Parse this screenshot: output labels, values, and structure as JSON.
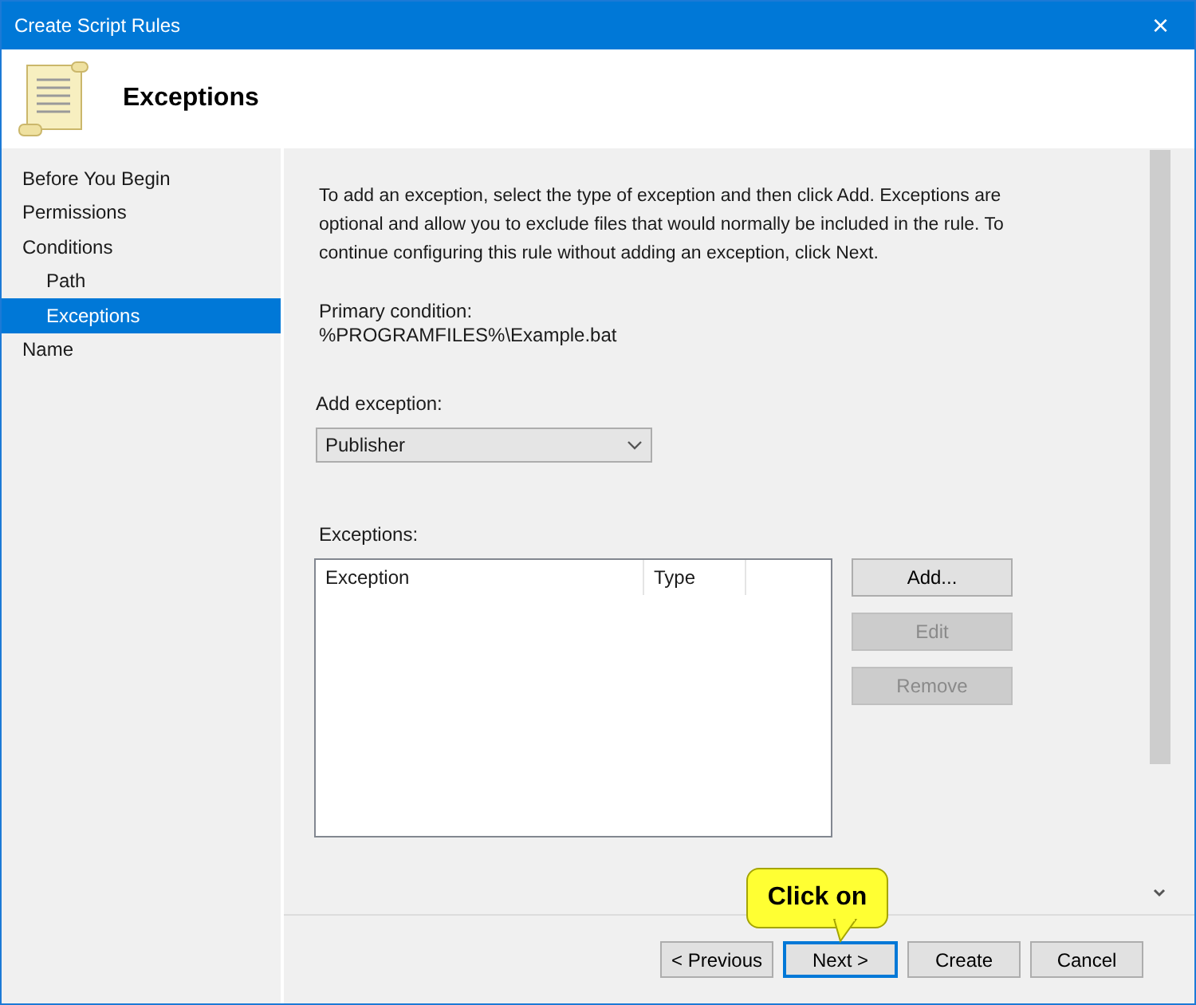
{
  "window": {
    "title": "Create Script Rules",
    "close": "×"
  },
  "header": {
    "title": "Exceptions"
  },
  "sidebar": {
    "items": [
      {
        "label": "Before You Begin",
        "selected": false
      },
      {
        "label": "Permissions",
        "selected": false
      },
      {
        "label": "Conditions",
        "selected": false,
        "children": [
          {
            "label": "Path",
            "selected": false
          },
          {
            "label": "Exceptions",
            "selected": true
          }
        ]
      },
      {
        "label": "Name",
        "selected": false
      }
    ]
  },
  "content": {
    "intro": "To add an exception, select the type of exception and then click Add. Exceptions are optional and allow you to exclude files that would normally be included in the rule. To continue configuring this rule without adding an exception, click Next.",
    "primary_condition_label": "Primary condition:",
    "primary_condition_value": "%PROGRAMFILES%\\Example.bat",
    "add_exception_label": "Add exception:",
    "add_exception_value": "Publisher",
    "exceptions_label": "Exceptions:",
    "table": {
      "columns": [
        "Exception",
        "Type"
      ]
    },
    "side_buttons": [
      {
        "label": "Add...",
        "disabled": false
      },
      {
        "label": "Edit",
        "disabled": true
      },
      {
        "label": "Remove",
        "disabled": true
      }
    ]
  },
  "footer_buttons": [
    {
      "label": "< Previous",
      "default": false
    },
    {
      "label": "Next >",
      "default": true
    },
    {
      "label": "Create",
      "default": false
    },
    {
      "label": "Cancel",
      "default": false
    }
  ],
  "callout": {
    "text": "Click on"
  }
}
